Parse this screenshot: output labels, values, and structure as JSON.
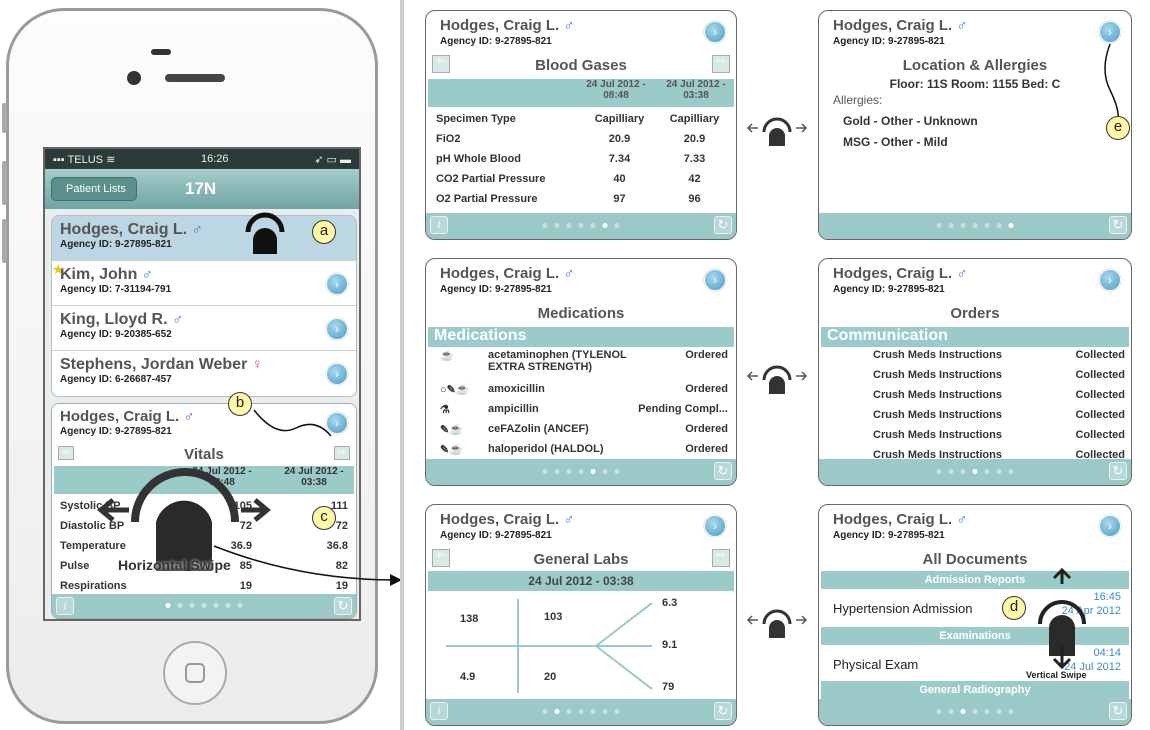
{
  "phone": {
    "status": {
      "carrier": "TELUS",
      "time": "16:26"
    },
    "nav": {
      "back_label": "Patient Lists",
      "title": "17N"
    },
    "patients": [
      {
        "name": "Hodges, Craig L.",
        "sex": "♂",
        "agency_id": "Agency ID: 9-27895-821",
        "selected": true,
        "starred": false
      },
      {
        "name": "Kim, John",
        "sex": "♂",
        "agency_id": "Agency ID: 7-31194-791",
        "selected": false,
        "starred": true
      },
      {
        "name": "King, Lloyd R.",
        "sex": "♂",
        "agency_id": "Agency ID: 9-20385-652",
        "selected": false,
        "starred": false
      },
      {
        "name": "Stephens, Jordan Weber",
        "sex": "♀",
        "agency_id": "Agency ID: 6-26687-457",
        "selected": false,
        "starred": false
      }
    ],
    "vitals_card": {
      "name": "Hodges, Craig L.",
      "sex": "♂",
      "agency_id": "Agency ID: 9-27895-821",
      "title": "Vitals",
      "col1": "24 Jul 2012 - 08:48",
      "col2": "24 Jul 2012 - 03:38",
      "rows": [
        {
          "label": "Systolic BP",
          "v1": "105",
          "v2": "111"
        },
        {
          "label": "Diastolic BP",
          "v1": "72",
          "v2": "72"
        },
        {
          "label": "Temperature",
          "v1": "36.9",
          "v2": "36.8"
        },
        {
          "label": "Pulse",
          "v1": "85",
          "v2": "82"
        },
        {
          "label": "Respirations",
          "v1": "19",
          "v2": "19"
        }
      ],
      "gesture_label": "Horizontal Swipe"
    }
  },
  "callouts": {
    "a": "a",
    "b": "b",
    "c": "c",
    "d": "d",
    "e": "e"
  },
  "cards": {
    "patient_name": "Hodges, Craig L.",
    "patient_sex": "♂",
    "agency_id": "Agency ID: 9-27895-821",
    "blood_gases": {
      "title": "Blood Gases",
      "col1": "24 Jul 2012 - 08:48",
      "col2": "24 Jul 2012 - 03:38",
      "rows": [
        {
          "label": "Specimen Type",
          "v1": "Capilliary",
          "v2": "Capilliary"
        },
        {
          "label": "FiO2",
          "v1": "20.9",
          "v2": "20.9"
        },
        {
          "label": "pH Whole Blood",
          "v1": "7.34",
          "v2": "7.33"
        },
        {
          "label": "CO2 Partial Pressure",
          "v1": "40",
          "v2": "42"
        },
        {
          "label": "O2 Partial Pressure",
          "v1": "97",
          "v2": "96"
        }
      ]
    },
    "location": {
      "title": "Location & Allergies",
      "floor_line": "Floor: 11S   Room: 1155   Bed: C",
      "allergies_label": "Allergies:",
      "allergies": [
        "Gold - Other - Unknown",
        "MSG - Other - Mild"
      ]
    },
    "medications": {
      "title": "Medications",
      "section": "Medications",
      "rows": [
        {
          "icons": "☕",
          "name": "acetaminophen (TYLENOL EXTRA STRENGTH)",
          "status": "Ordered"
        },
        {
          "icons": "○✎☕",
          "name": "amoxicillin",
          "status": "Ordered"
        },
        {
          "icons": "⚗",
          "name": "ampicillin",
          "status": "Pending Compl..."
        },
        {
          "icons": "✎☕",
          "name": "ceFAZolin (ANCEF)",
          "status": "Ordered"
        },
        {
          "icons": "✎☕",
          "name": "haloperidol (HALDOL)",
          "status": "Ordered"
        }
      ]
    },
    "orders": {
      "title": "Orders",
      "section": "Communication",
      "rows": [
        {
          "name": "Crush Meds Instructions",
          "status": "Collected"
        },
        {
          "name": "Crush Meds Instructions",
          "status": "Collected"
        },
        {
          "name": "Crush Meds Instructions",
          "status": "Collected"
        },
        {
          "name": "Crush Meds Instructions",
          "status": "Collected"
        },
        {
          "name": "Crush Meds Instructions",
          "status": "Collected"
        },
        {
          "name": "Crush Meds Instructions",
          "status": "Collected"
        }
      ]
    },
    "general_labs": {
      "title": "General Labs",
      "date": "24 Jul 2012 - 03:38",
      "values": {
        "tl": "138",
        "tm": "103",
        "bl": "4.9",
        "bm": "20",
        "r1": "6.3",
        "r2": "9.1",
        "r3": "79"
      }
    },
    "documents": {
      "title": "All Documents",
      "sections": [
        {
          "header": "Admission Reports",
          "item": "Hypertension Admission",
          "time": "16:45",
          "date": "24 Apr 2012"
        },
        {
          "header": "Examinations",
          "item": "Physical Exam",
          "time": "04:14",
          "date": "24 Jul 2012"
        }
      ],
      "footer_section": "General Radiography",
      "gesture_label": "Vertical Swipe"
    }
  }
}
